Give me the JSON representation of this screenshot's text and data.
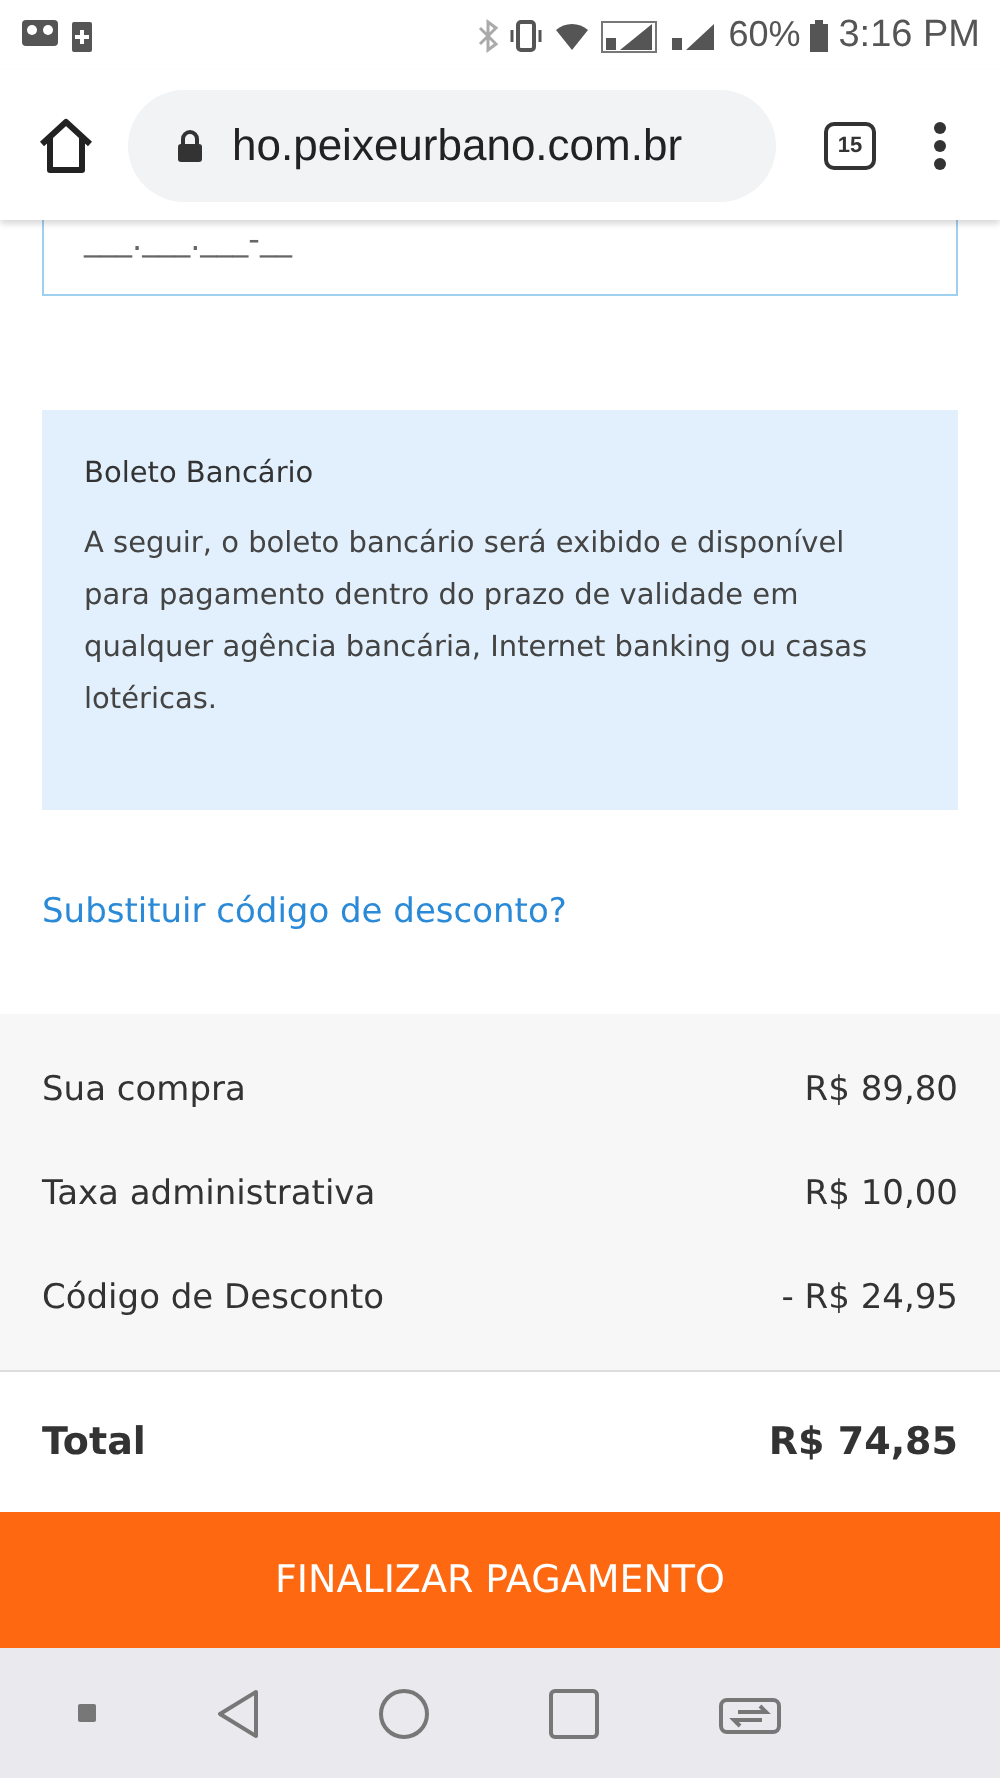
{
  "status_bar": {
    "battery": "60%",
    "time": "3:16 PM"
  },
  "browser": {
    "url": "ho.peixeurbano.com.br",
    "tab_count": "15"
  },
  "cpf_field": {
    "value": "___.___.___-__"
  },
  "payment_info": {
    "title": "Boleto Bancário",
    "text": "A seguir, o boleto bancário será exibido e disponível para pagamento dentro do prazo de validade em qualquer agência bancária, Internet banking ou casas lotéricas."
  },
  "discount_link": "Substituir código de desconto?",
  "summary": [
    {
      "label": "Sua compra",
      "value": "R$ 89,80"
    },
    {
      "label": "Taxa administrativa",
      "value": "R$ 10,00"
    },
    {
      "label": "Código de Desconto",
      "value": "- R$ 24,95"
    }
  ],
  "total": {
    "label": "Total",
    "value": "R$ 74,85"
  },
  "pay_button": "FINALIZAR PAGAMENTO"
}
